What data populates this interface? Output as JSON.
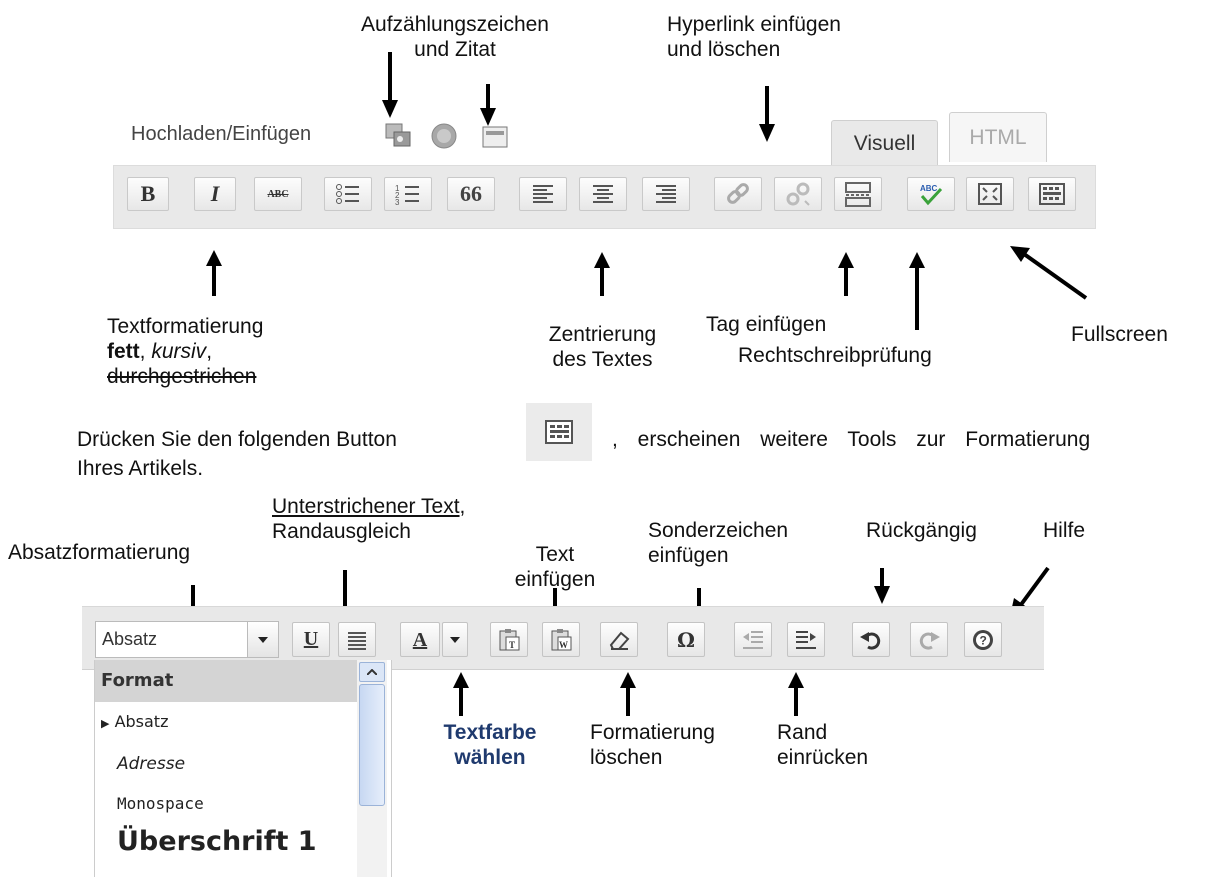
{
  "top_annotations": {
    "bullets_line1": "Aufzählungszeichen",
    "bullets_line2": "und Zitat",
    "hyperlink_line1": "Hyperlink einfügen",
    "hyperlink_line2": "und löschen",
    "upload_label": "Hochladen/Einfügen",
    "text_format_line1": "Textformatierung",
    "text_format_bold": "fett",
    "text_format_comma1": ", ",
    "text_format_italic": "kursiv",
    "text_format_comma2": ",",
    "text_format_strike": "durchgestrichen",
    "center_line1": "Zentrierung",
    "center_line2": "des Textes",
    "tag_insert": "Tag einfügen",
    "spellcheck": "Rechtschreibprüfung",
    "fullscreen": "Fullscreen"
  },
  "editor_tabs": {
    "visual": "Visuell",
    "html": "HTML"
  },
  "toolbar1": {
    "bold_glyph": "B",
    "italic_glyph": "I",
    "strike_glyph": "ABC",
    "quote_glyph": "66"
  },
  "paragraph": {
    "part1": "Drücken Sie den folgenden Button",
    "part2": ", erscheinen weitere Tools zur Formatierung",
    "line2": "Ihres Artikels."
  },
  "bottom_annotations": {
    "underline_line1": "Unterstrichener Text",
    "underline_comma": ",",
    "underline_line2": "Randausgleich",
    "paragraph_format": "Absatzformatierung",
    "text_insert_line1": "Text",
    "text_insert_line2": "einfügen",
    "special_line1": "Sonderzeichen",
    "special_line2": "einfügen",
    "undo": "Rückgängig",
    "help": "Hilfe",
    "textcolor_line1": "Textfarbe",
    "textcolor_line2": "wählen",
    "clearformat_line1": "Formatierung",
    "clearformat_line2": "löschen",
    "indent_line1": "Rand",
    "indent_line2": "einrücken"
  },
  "toolbar2": {
    "format_select_value": "Absatz",
    "underline_glyph": "U",
    "color_glyph": "A",
    "omega_glyph": "Ω"
  },
  "format_dropdown": {
    "header": "Format",
    "items": [
      "Absatz",
      "Adresse",
      "Monospace",
      "Überschrift 1"
    ]
  },
  "colors": {
    "textcolor_label": "#1f3a6e",
    "spell_check_green": "#3aa23a",
    "spell_check_blue": "#2a5db0"
  }
}
